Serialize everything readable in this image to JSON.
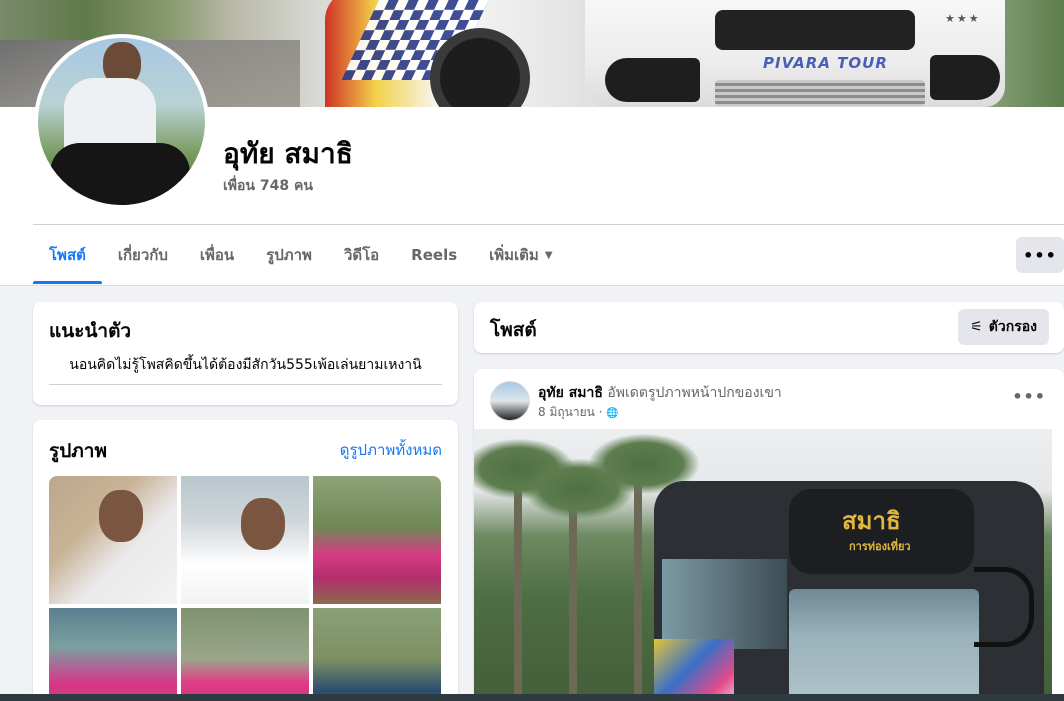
{
  "profile": {
    "name": "อุทัย สมาธิ",
    "friends": "เพื่อน 748 คน",
    "cover_text": "PIVARA TOUR",
    "cover_stars": "★★★"
  },
  "tabs": [
    {
      "label": "โพสต์",
      "active": true
    },
    {
      "label": "เกี่ยวกับ",
      "active": false
    },
    {
      "label": "เพื่อน",
      "active": false
    },
    {
      "label": "รูปภาพ",
      "active": false
    },
    {
      "label": "วิดีโอ",
      "active": false
    },
    {
      "label": "Reels",
      "active": false
    },
    {
      "label": "เพิ่มเติม",
      "active": false
    }
  ],
  "tabs_more_caret": "▼",
  "more_button": "•••",
  "intro": {
    "title": "แนะนำตัว",
    "bio": "นอนคิดไม่รู้โพสคิดขึ้นได้ต้องมีสักวัน555เพ้อเล่นยามเหงานิ"
  },
  "photos": {
    "title": "รูปภาพ",
    "see_all": "ดูรูปภาพทั้งหมด"
  },
  "posts": {
    "title": "โพสต์",
    "filter_label": "ตัวกรอง",
    "filter_icon": "⚟"
  },
  "post": {
    "author": "อุทัย สมาธิ",
    "action": "อัพเดตรูปภาพหน้าปกของเขา",
    "date": "8 มิถุนายน",
    "privacy_separator": " · ",
    "privacy_icon": "🌐",
    "more": "•••",
    "image_logo": "สมาธิ",
    "image_sub": "การท่องเที่ยว"
  },
  "colors": {
    "accent": "#1877f2",
    "background": "#f0f2f5",
    "card": "#ffffff",
    "secondary_text": "#65676b"
  }
}
